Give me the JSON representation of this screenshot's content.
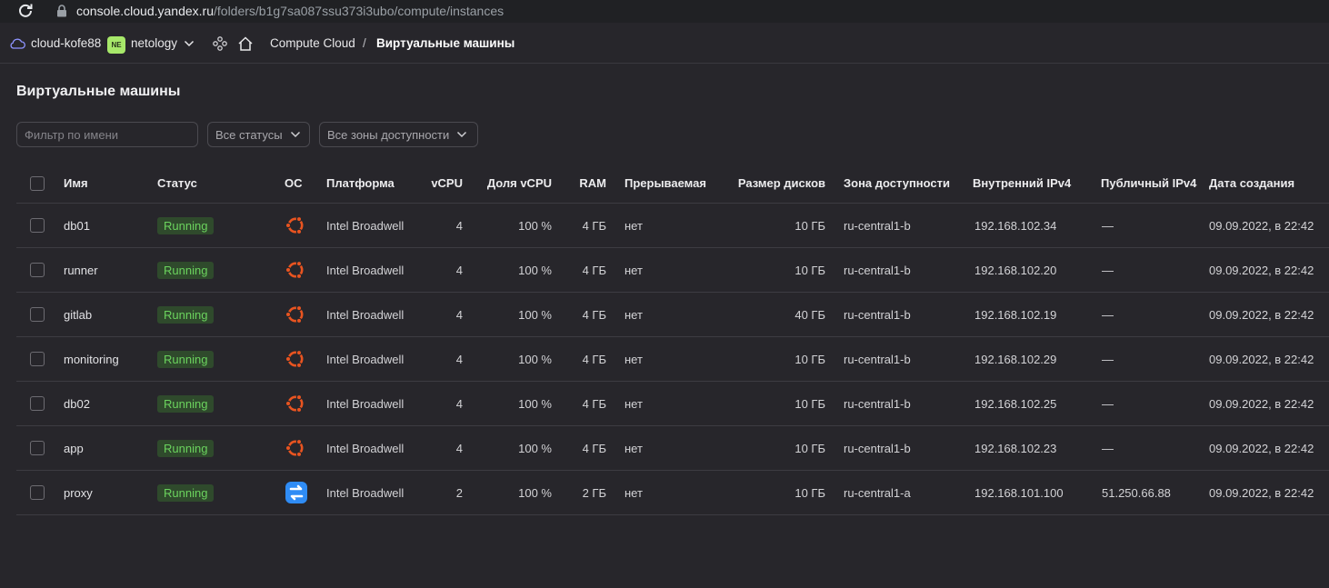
{
  "browser": {
    "url_host": "console.cloud.yandex.ru",
    "url_path": "/folders/b1g7sa087ssu373i3ubo/compute/instances"
  },
  "header": {
    "cloud_name": "cloud-kofe88",
    "folder_badge": "NE",
    "folder_name": "netology",
    "breadcrumb_service": "Compute Cloud",
    "breadcrumb_separator": "/",
    "breadcrumb_current": "Виртуальные машины"
  },
  "page": {
    "title": "Виртуальные машины",
    "filter_placeholder": "Фильтр по имени",
    "status_select": "Все статусы",
    "zone_select": "Все зоны доступности"
  },
  "table": {
    "columns": {
      "name": "Имя",
      "status": "Статус",
      "os": "ОС",
      "platform": "Платформа",
      "vcpu": "vCPU",
      "share": "Доля vCPU",
      "ram": "RAM",
      "preemptible": "Прерываемая",
      "disk": "Размер дисков",
      "zone": "Зона доступности",
      "internal_ip": "Внутренний IPv4",
      "public_ip": "Публичный IPv4",
      "created": "Дата создания"
    },
    "rows": [
      {
        "name": "db01",
        "status": "Running",
        "os": "ubuntu-icon",
        "platform": "Intel Broadwell",
        "vcpu": "4",
        "share": "100 %",
        "ram": "4 ГБ",
        "preemptible": "нет",
        "disk": "10 ГБ",
        "zone": "ru-central1-b",
        "internal_ip": "192.168.102.34",
        "public_ip": "—",
        "created": "09.09.2022, в 22:42"
      },
      {
        "name": "runner",
        "status": "Running",
        "os": "ubuntu-icon",
        "platform": "Intel Broadwell",
        "vcpu": "4",
        "share": "100 %",
        "ram": "4 ГБ",
        "preemptible": "нет",
        "disk": "10 ГБ",
        "zone": "ru-central1-b",
        "internal_ip": "192.168.102.20",
        "public_ip": "—",
        "created": "09.09.2022, в 22:42"
      },
      {
        "name": "gitlab",
        "status": "Running",
        "os": "ubuntu-icon",
        "platform": "Intel Broadwell",
        "vcpu": "4",
        "share": "100 %",
        "ram": "4 ГБ",
        "preemptible": "нет",
        "disk": "40 ГБ",
        "zone": "ru-central1-b",
        "internal_ip": "192.168.102.19",
        "public_ip": "—",
        "created": "09.09.2022, в 22:42"
      },
      {
        "name": "monitoring",
        "status": "Running",
        "os": "ubuntu-icon",
        "platform": "Intel Broadwell",
        "vcpu": "4",
        "share": "100 %",
        "ram": "4 ГБ",
        "preemptible": "нет",
        "disk": "10 ГБ",
        "zone": "ru-central1-b",
        "internal_ip": "192.168.102.29",
        "public_ip": "—",
        "created": "09.09.2022, в 22:42"
      },
      {
        "name": "db02",
        "status": "Running",
        "os": "ubuntu-icon",
        "platform": "Intel Broadwell",
        "vcpu": "4",
        "share": "100 %",
        "ram": "4 ГБ",
        "preemptible": "нет",
        "disk": "10 ГБ",
        "zone": "ru-central1-b",
        "internal_ip": "192.168.102.25",
        "public_ip": "—",
        "created": "09.09.2022, в 22:42"
      },
      {
        "name": "app",
        "status": "Running",
        "os": "ubuntu-icon",
        "platform": "Intel Broadwell",
        "vcpu": "4",
        "share": "100 %",
        "ram": "4 ГБ",
        "preemptible": "нет",
        "disk": "10 ГБ",
        "zone": "ru-central1-b",
        "internal_ip": "192.168.102.23",
        "public_ip": "—",
        "created": "09.09.2022, в 22:42"
      },
      {
        "name": "proxy",
        "status": "Running",
        "os": "nat-instance-icon",
        "platform": "Intel Broadwell",
        "vcpu": "2",
        "share": "100 %",
        "ram": "2 ГБ",
        "preemptible": "нет",
        "disk": "10 ГБ",
        "zone": "ru-central1-a",
        "internal_ip": "192.168.101.100",
        "public_ip": "51.250.66.88",
        "created": "09.09.2022, в 22:42"
      }
    ]
  },
  "colors": {
    "background": "#27262b",
    "status_running_text": "#6bd35e",
    "status_running_bg": "#2f4a2c",
    "ubuntu_orange": "#e95420",
    "nat_blue": "#2f8cf5",
    "folder_badge": "#a7e86a"
  }
}
